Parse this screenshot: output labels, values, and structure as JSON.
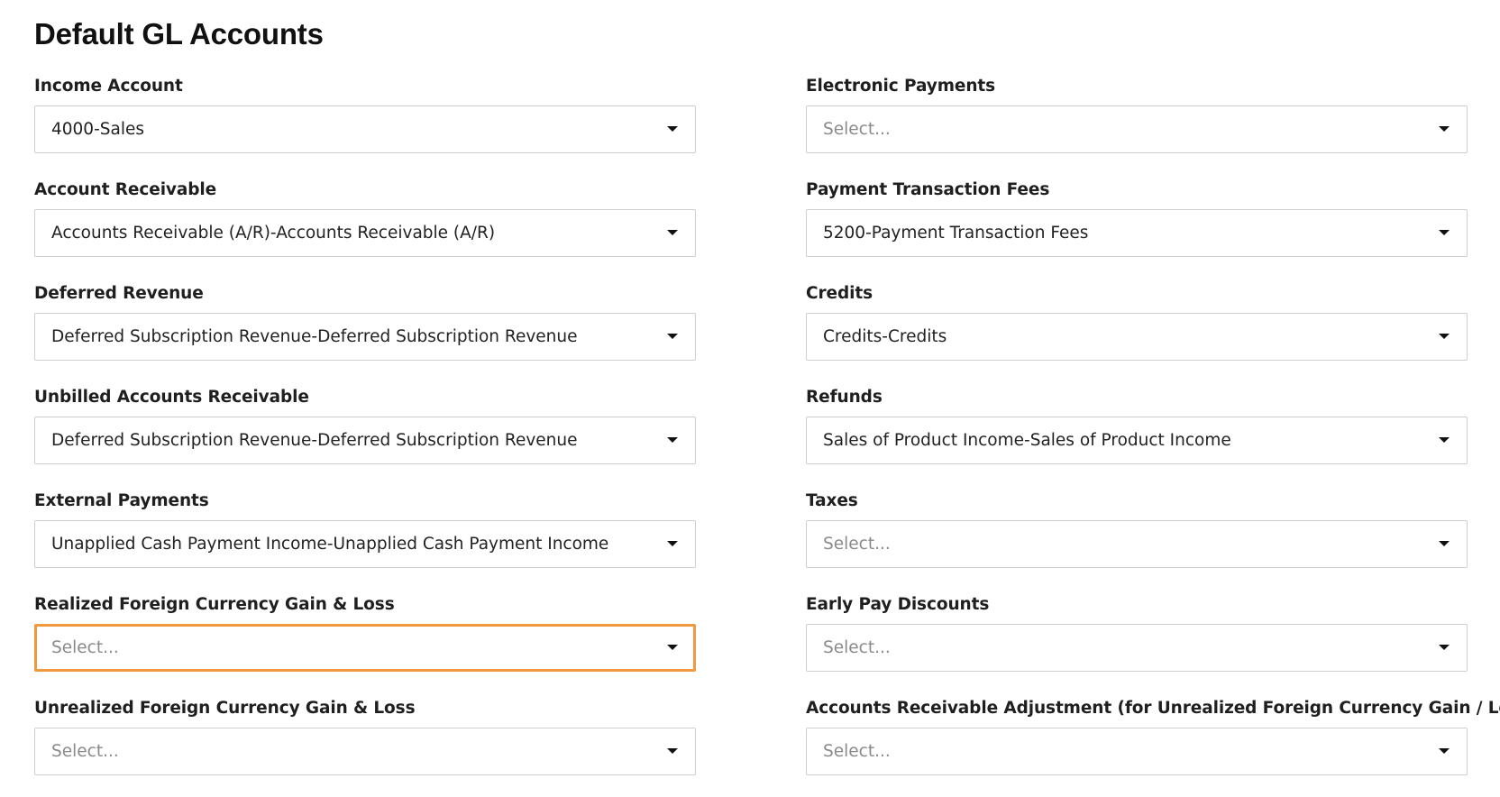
{
  "page": {
    "title": "Default GL Accounts"
  },
  "colors": {
    "focus_border": "#f0993e",
    "field_border": "#cfcfcf",
    "placeholder_text": "#8a8a8a"
  },
  "icons": {
    "dropdown": "chevron-down-icon"
  },
  "fields": {
    "income_account": {
      "label": "Income Account",
      "value": "4000-Sales"
    },
    "electronic_payments": {
      "label": "Electronic Payments",
      "placeholder": "Select..."
    },
    "account_receivable": {
      "label": "Account Receivable",
      "value": "Accounts Receivable (A/R)-Accounts Receivable (A/R)"
    },
    "payment_transaction_fees": {
      "label": "Payment Transaction Fees",
      "value": "5200-Payment Transaction Fees"
    },
    "deferred_revenue": {
      "label": "Deferred Revenue",
      "value": "Deferred Subscription Revenue-Deferred Subscription Revenue"
    },
    "credits": {
      "label": "Credits",
      "value": "Credits-Credits"
    },
    "unbilled_accounts_receivable": {
      "label": "Unbilled Accounts Receivable",
      "value": "Deferred Subscription Revenue-Deferred Subscription Revenue"
    },
    "refunds": {
      "label": "Refunds",
      "value": "Sales of Product Income-Sales of Product Income"
    },
    "external_payments": {
      "label": "External Payments",
      "value": "Unapplied Cash Payment Income-Unapplied Cash Payment Income"
    },
    "taxes": {
      "label": "Taxes",
      "placeholder": "Select..."
    },
    "realized_fx": {
      "label": "Realized Foreign Currency Gain & Loss",
      "placeholder": "Select...",
      "focused": true
    },
    "early_pay_discounts": {
      "label": "Early Pay Discounts",
      "placeholder": "Select..."
    },
    "unrealized_fx": {
      "label": "Unrealized Foreign Currency Gain & Loss",
      "placeholder": "Select..."
    },
    "ar_adjustment": {
      "label": "Accounts Receivable Adjustment (for Unrealized Foreign Currency Gain / Loss)",
      "placeholder": "Select..."
    }
  }
}
